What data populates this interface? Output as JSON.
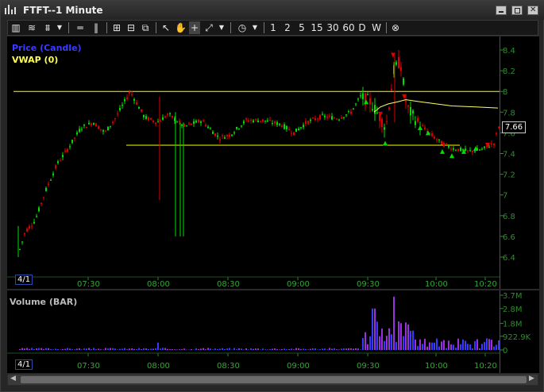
{
  "window": {
    "title": "FTFT--1 Minute"
  },
  "toolbar": {
    "nums": [
      "1",
      "2",
      "5",
      "15",
      "30",
      "60",
      "D",
      "W"
    ]
  },
  "price_pane": {
    "legend_price": "Price (Candle)",
    "legend_vwap": "VWAP (0)",
    "last_price": "7.66",
    "nav": "4/1"
  },
  "volume_pane": {
    "legend": "Volume (BAR)",
    "nav": "4/1"
  },
  "colors": {
    "up": "#00e000",
    "down": "#e00000",
    "vwap": "#ffff66",
    "level": "#ffff00",
    "volume": "#3a3aff",
    "volume_alt": "#9a30e0",
    "axis": "#2d8d2d"
  },
  "chart_data": [
    {
      "type": "candlestick",
      "title": "Price (Candle)",
      "series": [
        {
          "name": "VWAP (0)"
        }
      ],
      "x_ticks": [
        "07:30",
        "08:00",
        "08:30",
        "09:00",
        "09:30",
        "10:00",
        "10:20"
      ],
      "y_ticks": [
        "8.4",
        "8.2",
        "8",
        "7.8",
        "7.6",
        "7.4",
        "7.2",
        "7",
        "6.8",
        "6.6",
        "6.4"
      ],
      "ylim": [
        6.35,
        8.45
      ],
      "horizontal_levels": [
        8.0,
        7.48
      ],
      "last": 7.66
    },
    {
      "type": "bar",
      "title": "Volume (BAR)",
      "x_ticks": [
        "07:30",
        "08:00",
        "08:30",
        "09:00",
        "09:30",
        "10:00",
        "10:20"
      ],
      "y_ticks": [
        "3.7M",
        "2.8M",
        "1.8M",
        "922.9K",
        "0"
      ],
      "ylim": [
        0,
        3700000
      ]
    }
  ]
}
